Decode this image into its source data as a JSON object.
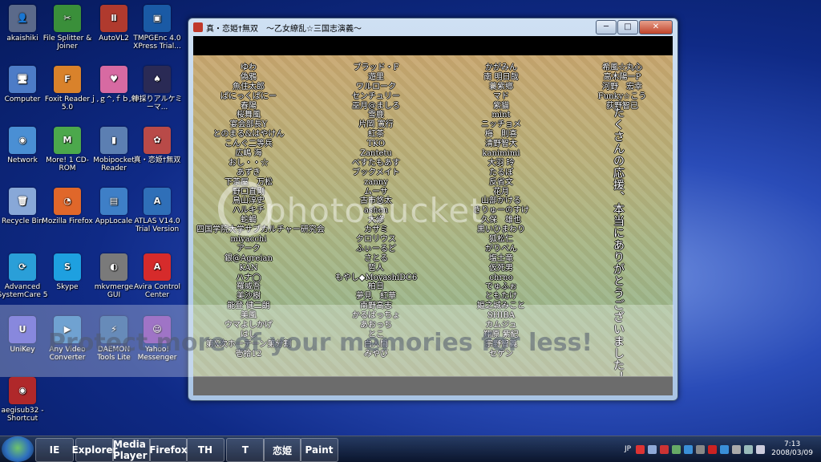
{
  "desktop_icons": [
    {
      "label": "akaishiki",
      "color": "#5b6a8a",
      "glyph": "👤"
    },
    {
      "label": "File Splitter & Joiner",
      "color": "#3a8f3a",
      "glyph": "✂"
    },
    {
      "label": "AutoVL2",
      "color": "#b03a2e",
      "glyph": "Ⅱ"
    },
    {
      "label": "TMPGEnc 4.0 XPress Trial...",
      "color": "#1a5aa5",
      "glyph": "▣"
    },
    {
      "label": "Computer",
      "color": "#4d7cc7",
      "glyph": "🖥"
    },
    {
      "label": "Foxit Reader 5.0",
      "color": "#d9822b",
      "glyph": "F"
    },
    {
      "label": "ｊ,ｇ^,ｆｂ,f1",
      "color": "#d76aa2",
      "glyph": "♥"
    },
    {
      "label": "神採りアルケミーマ...",
      "color": "#2a2a55",
      "glyph": "♠"
    },
    {
      "label": "Network",
      "color": "#4a8fd4",
      "glyph": "◉"
    },
    {
      "label": "More! 1 CD-ROM",
      "color": "#4ca84c",
      "glyph": "M"
    },
    {
      "label": "Mobipocket Reader",
      "color": "#5c7fb2",
      "glyph": "▮"
    },
    {
      "label": "真・恋姫†無双",
      "color": "#b94a48",
      "glyph": "✿"
    },
    {
      "label": "Recycle Bin",
      "color": "#88a8d8",
      "glyph": "🗑"
    },
    {
      "label": "Mozilla Firefox",
      "color": "#e0672a",
      "glyph": "◔"
    },
    {
      "label": "AppLocale",
      "color": "#3e7fc7",
      "glyph": "▤"
    },
    {
      "label": "ATLAS V14.0 Trial Version",
      "color": "#2f6fb8",
      "glyph": "A"
    },
    {
      "label": "Advanced SystemCare 5",
      "color": "#2a9fd8",
      "glyph": "⟳"
    },
    {
      "label": "Skype",
      "color": "#1ea0e0",
      "glyph": "S"
    },
    {
      "label": "mkvmerge GUI",
      "color": "#7a7a7a",
      "glyph": "◐"
    },
    {
      "label": "Avira Control Center",
      "color": "#d62b2b",
      "glyph": "A"
    },
    {
      "label": "UniKey",
      "color": "#5a5ad0",
      "glyph": "U"
    },
    {
      "label": "Any Video Converter",
      "color": "#3a7fc0",
      "glyph": "▶"
    },
    {
      "label": "DAEMON Tools Lite",
      "color": "#2d5f9e",
      "glyph": "⚡"
    },
    {
      "label": "Yahoo! Messenger",
      "color": "#7a3fb0",
      "glyph": "☺"
    },
    {
      "label": "aegisub32 - Shortcut",
      "color": "#b0282a",
      "glyph": "◉"
    }
  ],
  "window": {
    "title": "真・恋姫†無双　～乙女繚乱☆三国志演義～",
    "min_glyph": "─",
    "max_glyph": "□",
    "close_glyph": "✕"
  },
  "credits": {
    "col1": [
      "ゆわ",
      "偽鴉",
      "魚住太郎",
      "ぱにっくぱにー",
      "春陽",
      "桜舞風",
      "宴会部長Y",
      "とのまる&はやけん",
      "こんぐ二等兵",
      "広嶋 海",
      "おし・・☆",
      "あずき",
      "下茶屋　万松",
      "野口直剛",
      "鳥山淳史",
      "ハルキチ",
      "蛇蝎",
      "四国学院大学サブカルチャー研究会",
      "miyacchi",
      "アーク",
      "銀@Agreian",
      "KAN",
      "ハナ◯",
      "羅威吾",
      "美沙樹",
      "能登 健二朗",
      "美風",
      "ウマよしかげ",
      "はし",
      "第X次ホーデーン第分割",
      "壱拾12"
    ],
    "col2": [
      "ブラッド・F",
      "遊里",
      "ワルローク",
      "センチュリー",
      "巫月@ましろ",
      "雪鹿",
      "片岡 寛行",
      "紅茶",
      "TKO",
      "Zantetu",
      "べすたもあす",
      "ブックメイト",
      "zanny",
      "ムーサ",
      "古市悠太",
      "ashen",
      "大修",
      "カザミ",
      "クロリウス",
      "ふぃーるど",
      "さとる",
      "哲人",
      "もやし◆MoyashiDC6",
      "柏日",
      "夢見　紅華",
      "南野高志",
      "かるばっちょ",
      "あおっち",
      "とこ",
      "白人間",
      "みやび"
    ],
    "col3": [
      "かがみん",
      "南 明日哉",
      "蓑紫鄕",
      "マド",
      "紫貓",
      "mint",
      "ニッチョメ",
      "梅　則喜",
      "清野智大",
      "kanimimi",
      "大羽 玲",
      "たるぽ",
      "反省文",
      "花月",
      "山部かける",
      "きりゅーのすけ",
      "久保　雄也",
      "黒いひまわり",
      "狐松仁",
      "がりべん",
      "塩土竜",
      "仮死男",
      "chrno",
      "でゅふぉ",
      "ともたけ",
      "姫之城みこと",
      "SHIBA",
      "カムジュ",
      "翔原 紫紀",
      "宗野智義",
      "セゲン"
    ],
    "col4": [
      "希風☆丸心",
      "高木陽一P",
      "河野　宏幸",
      "Funky☆こう",
      "荻野智已"
    ],
    "thanks": "たくさんの応援、本当にありがとうございました！"
  },
  "watermark": {
    "brand": "photobucket",
    "tagline": "Protect more of your memories for less!"
  },
  "taskbar": {
    "pinned": [
      "IE",
      "Explorer",
      "Media Player",
      "Firefox",
      "TH",
      "T",
      "恋姫",
      "Paint"
    ],
    "language": "JP",
    "time": "7:13",
    "date": "2008/03/09"
  }
}
